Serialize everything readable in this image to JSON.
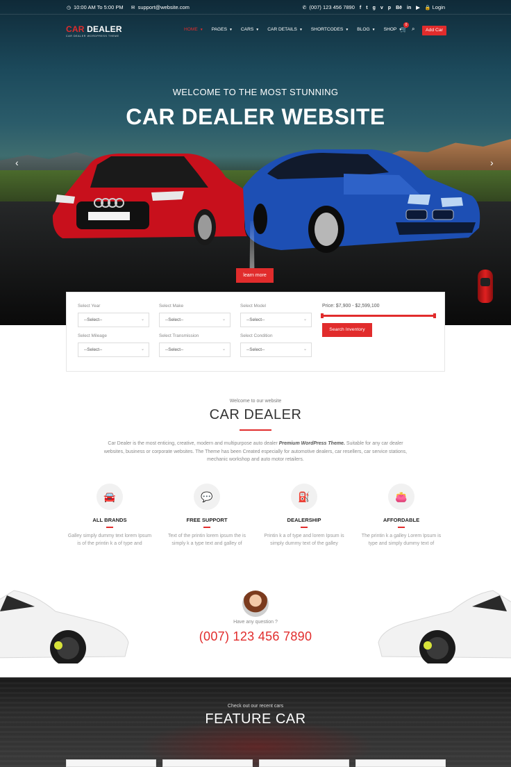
{
  "topbar": {
    "hours": "10:00 AM To 5:00 PM",
    "email": "support@website.com",
    "phone": "(007) 123 456 7890",
    "social": [
      "f",
      "t",
      "g",
      "v",
      "p",
      "Bē",
      "in",
      "▶"
    ],
    "login": "Login"
  },
  "brand": {
    "logo_car": "CAR",
    "logo_dealer": " DEALER",
    "tagline": "CAR DEALER WORDPRESS THEME"
  },
  "nav": {
    "items": [
      "HOME",
      "PAGES",
      "CARS",
      "CAR DETAILS",
      "SHORTCODES",
      "BLOG",
      "SHOP"
    ],
    "cart_count": "0",
    "add_car": "Add Car"
  },
  "hero": {
    "subtitle": "WELCOME TO THE MOST STUNNING",
    "title": "CAR DEALER WEBSITE",
    "button": "learn more"
  },
  "search": {
    "fields": [
      {
        "label": "Select Year",
        "value": "--Select--"
      },
      {
        "label": "Select Make",
        "value": "--Select--"
      },
      {
        "label": "Select Model",
        "value": "--Select--"
      },
      {
        "label": "Select Mileage",
        "value": "--Select--"
      },
      {
        "label": "Select Transmission",
        "value": "--Select--"
      },
      {
        "label": "Select Condition",
        "value": "--Select--"
      }
    ],
    "price_label": "Price:  $7,900 - $2,599,100",
    "button": "Search Inventory"
  },
  "welcome": {
    "small": "Welcome to our website",
    "title": "CAR DEALER",
    "para_start": "Car Dealer is the most enticing, creative, modern and multipurpose auto dealer ",
    "para_bold": "Premium WordPress Theme.",
    "para_end": " Suitable for any car dealer websites, business or corporate websites. The Theme has been Created especially for automotive dealers, car resellers, car service stations, mechanic workshop and auto motor retailers."
  },
  "features": [
    {
      "icon": "car-icon",
      "title": "ALL BRANDS",
      "text": "Galley simply dummy text lorem Ipsum is of the printin k a of type and"
    },
    {
      "icon": "support-icon",
      "title": "FREE SUPPORT",
      "text": "Text of the printin lorem ipsum the is simply k a type text and galley of"
    },
    {
      "icon": "dealership-icon",
      "title": "DEALERSHIP",
      "text": "Printin k a of type and lorem Ipsum is simply dummy text of the galley"
    },
    {
      "icon": "wallet-icon",
      "title": "AFFORDABLE",
      "text": "The printin k a galley Lorem Ipsum is type and simply dummy text of"
    }
  ],
  "contact": {
    "question": "Have any question ?",
    "phone": "(007) 123 456 7890"
  },
  "feature_car": {
    "small": "Check out our recent cars",
    "title": "FEATURE CAR"
  },
  "colors": {
    "accent": "#e12c2c"
  }
}
